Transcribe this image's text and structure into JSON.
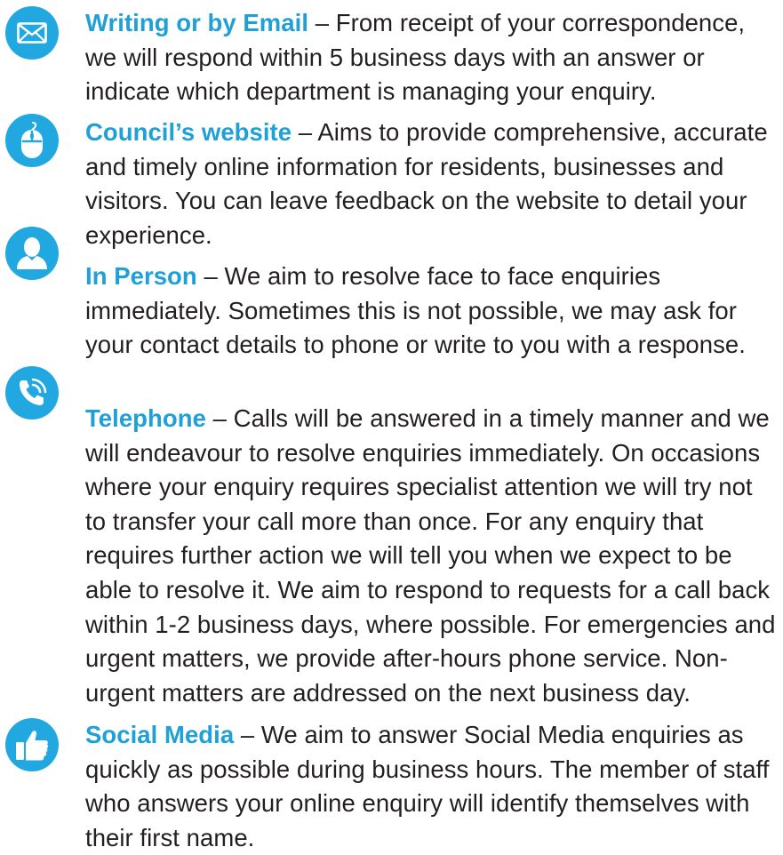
{
  "accent_color": "#22a8e0",
  "items": [
    {
      "icon": "envelope-icon",
      "heading": "Writing or by Email",
      "separator": " – ",
      "body": "From receipt of your correspondence, we will respond within 5 business days with an answer or indicate which department is managing your enquiry."
    },
    {
      "icon": "mouse-icon",
      "heading": "Council’s website",
      "separator": " – ",
      "body": "Aims to provide comprehensive, accurate and timely online information for residents, businesses and visitors. You can leave feedback on the website to detail your experience."
    },
    {
      "icon": "person-icon",
      "heading": "In Person",
      "separator": " – ",
      "body": "We aim to resolve face to face enquiries immediately. Sometimes this is not possible, we may ask for your contact details to phone or write to you with a response."
    },
    {
      "icon": "phone-icon",
      "heading": "Telephone",
      "separator": " – ",
      "body": "Calls will be answered in a timely manner and we will endeavour to resolve enquiries immediately. On occasions where your enquiry requires specialist attention we will try not to transfer your call more than once. For any enquiry that requires further action we will tell you when we expect to be able to resolve it. We aim to respond to requests for a call back within 1-2 business days, where possible. For emergencies and urgent matters, we provide after-hours phone service. Non-urgent matters are addressed on the next business day."
    },
    {
      "icon": "thumbs-up-icon",
      "heading": "Social Media",
      "separator": " – ",
      "body": "We aim to answer Social Media enquiries as quickly as possible during business hours. The member of staff who answers your online enquiry will identify themselves with their first name."
    }
  ]
}
